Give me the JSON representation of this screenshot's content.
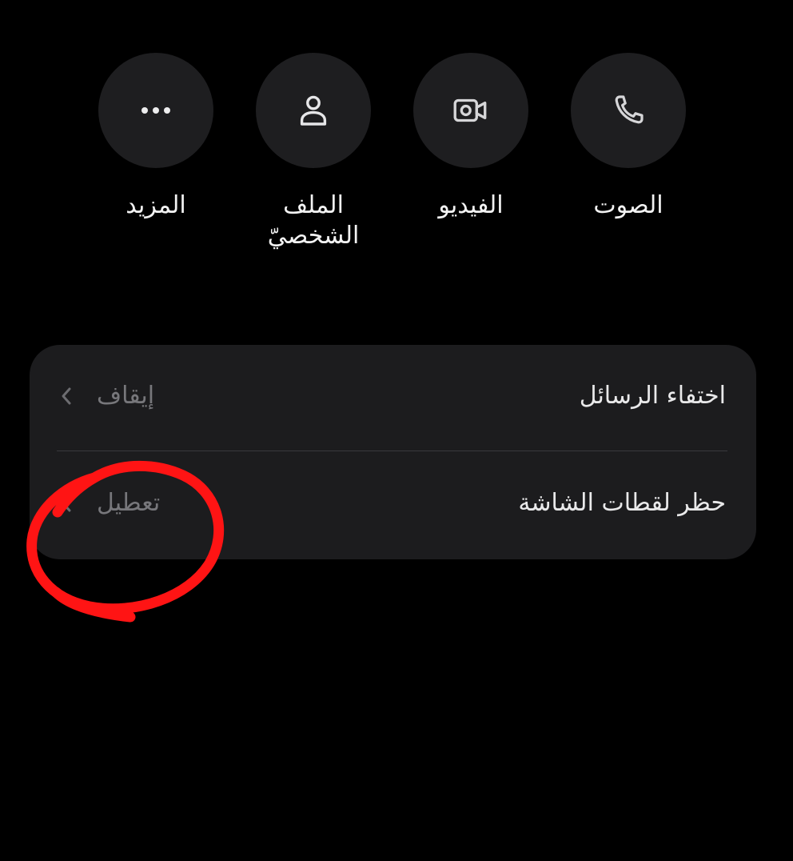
{
  "actions": [
    {
      "label": "الصوت",
      "icon": "phone-icon"
    },
    {
      "label": "الفيديو",
      "icon": "video-camera-icon"
    },
    {
      "label": "الملف الشخصيّ",
      "icon": "person-icon"
    },
    {
      "label": "المزيد",
      "icon": "ellipsis-icon"
    }
  ],
  "settings": {
    "disappearing_messages": {
      "title": "اختفاء الرسائل",
      "value": "إيقاف"
    },
    "screenshot_block": {
      "title": "حظر لقطات الشاشة",
      "value": "تعطيل"
    }
  },
  "colors": {
    "background": "#000000",
    "button_bg": "#1e1e20",
    "card_bg": "#1c1c1e",
    "annotation": "#ff1414"
  }
}
